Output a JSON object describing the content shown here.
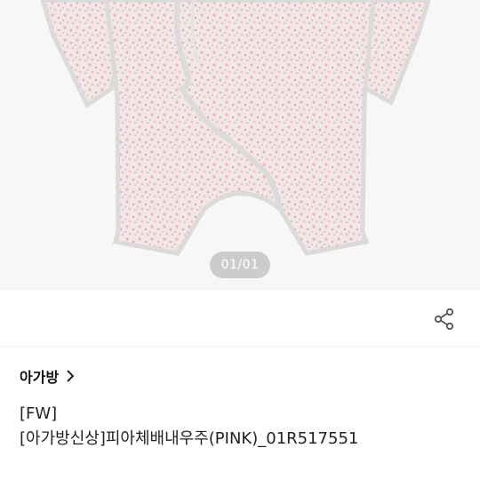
{
  "hero": {
    "image_alt": "floral romper",
    "counter": "01/01"
  },
  "actions": {
    "share_icon": "share-icon"
  },
  "brand": {
    "name": "아가방",
    "chevron_icon": "chevron-right-icon"
  },
  "product": {
    "title_line1": "[FW]",
    "title_line2": "[아가방신상]피아체배내우주(PINK)_01R517551"
  },
  "colors": {
    "background": "#ffffff",
    "hero_background": "#f7f7f7",
    "fabric": "#f1e3e3",
    "trim": "#dedcdc",
    "text": "#222222"
  }
}
